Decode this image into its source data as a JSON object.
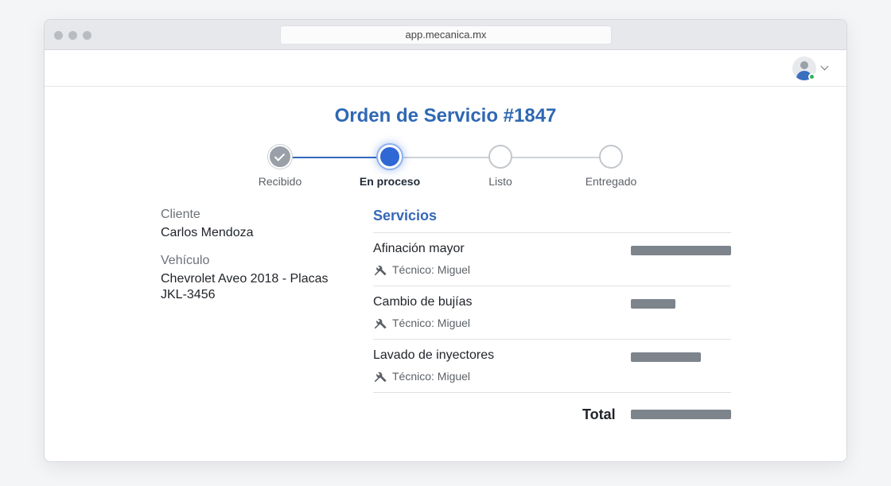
{
  "browser": {
    "url": "app.mecanica.mx"
  },
  "header": {
    "avatar_icon": "user-avatar-icon",
    "status": "online",
    "status_color": "#2fb457"
  },
  "order": {
    "title": "Orden de Servicio #1847"
  },
  "steps": [
    {
      "label": "Recibido",
      "state": "completed"
    },
    {
      "label": "En proceso",
      "state": "active"
    },
    {
      "label": "Listo",
      "state": "pending"
    },
    {
      "label": "Entregado",
      "state": "pending"
    }
  ],
  "client": {
    "label": "Cliente",
    "name": "Carlos Mendoza"
  },
  "vehicle": {
    "label": "Vehículo",
    "description": "Chevrolet Aveo 2018 - Placas JKL-3456"
  },
  "services": {
    "heading": "Servicios",
    "items": [
      {
        "name": "Afinación mayor",
        "technician": "Técnico: Miguel",
        "tool_icon": "wrench-screwdriver-icon",
        "price_redacted": true
      },
      {
        "name": "Cambio de bujías",
        "technician": "Técnico: Miguel",
        "tool_icon": "wrench-screwdriver-icon",
        "price_redacted": true
      },
      {
        "name": "Lavado de inyectores",
        "technician": "Técnico: Miguel",
        "tool_icon": "wrench-screwdriver-icon",
        "price_redacted": true
      }
    ],
    "total_label": "Total",
    "total_redacted": true
  },
  "colors": {
    "accent": "#2f68b3",
    "active_step": "#2f67d4",
    "redaction": "#7e848c"
  }
}
